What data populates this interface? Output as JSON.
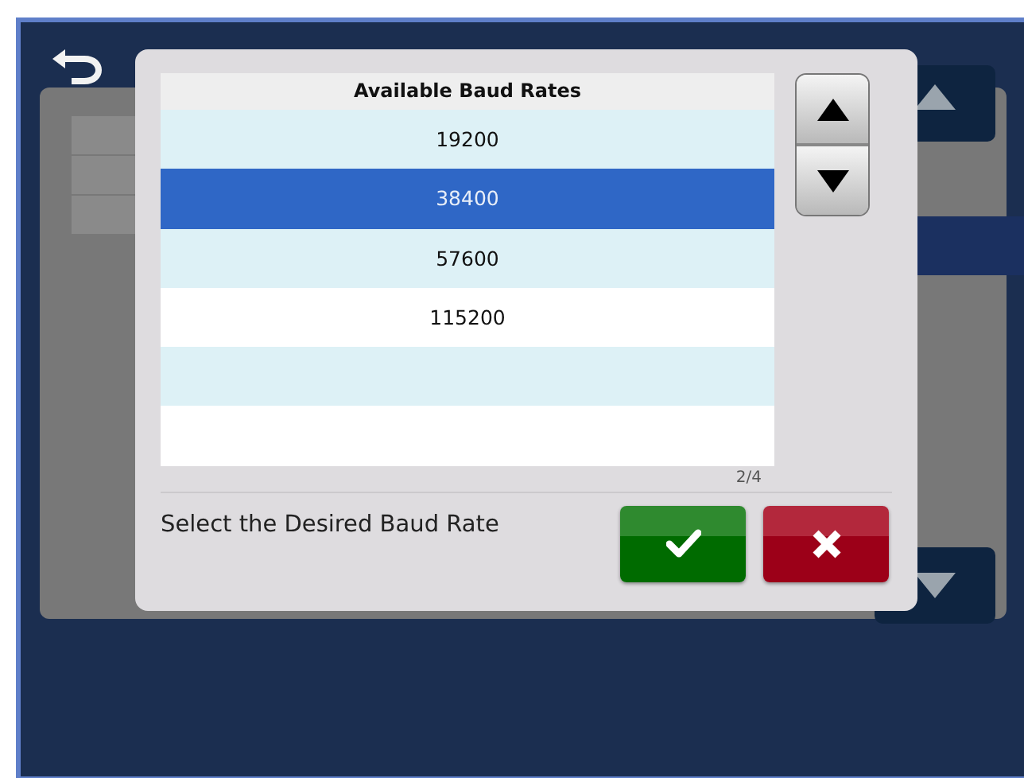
{
  "dialog": {
    "list": {
      "header": "Available Baud Rates",
      "rows": [
        {
          "label": "19200",
          "selected": false
        },
        {
          "label": "38400",
          "selected": true
        },
        {
          "label": "57600",
          "selected": false
        },
        {
          "label": "115200",
          "selected": false
        }
      ],
      "page_indicator": "2/4"
    },
    "prompt": "Select the Desired Baud Rate",
    "buttons": [
      {
        "kind": "confirm"
      },
      {
        "kind": "cancel"
      }
    ]
  }
}
